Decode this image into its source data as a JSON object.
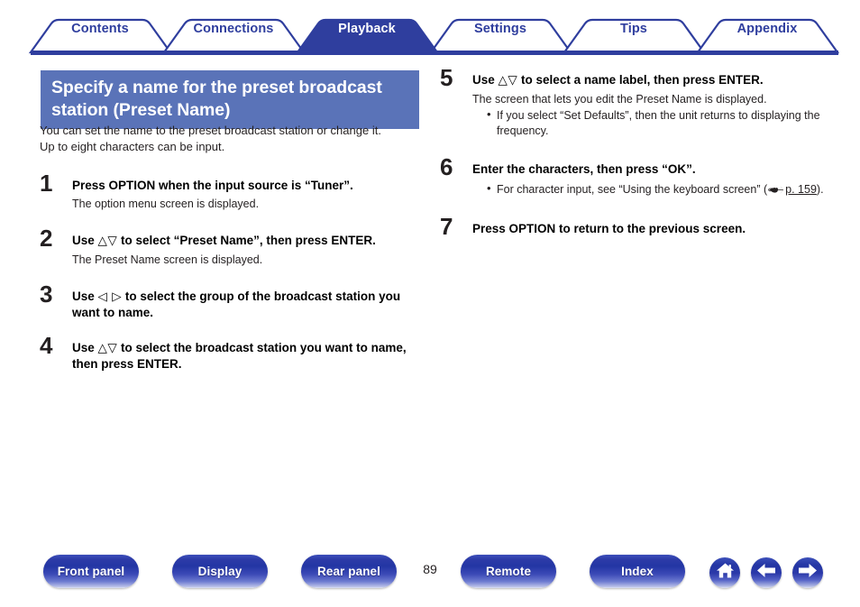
{
  "tabs": [
    {
      "label": "Contents",
      "active": false
    },
    {
      "label": "Connections",
      "active": false
    },
    {
      "label": "Playback",
      "active": true
    },
    {
      "label": "Settings",
      "active": false
    },
    {
      "label": "Tips",
      "active": false
    },
    {
      "label": "Appendix",
      "active": false
    }
  ],
  "heading": "Specify a name for the preset broadcast station (Preset Name)",
  "intro_line1": "You can set the name to the preset broadcast station or change it.",
  "intro_line2": "Up to eight characters can be input.",
  "steps_left": [
    {
      "num": "1",
      "title": "Press OPTION when the input source is “Tuner”.",
      "desc": "The option menu screen is displayed."
    },
    {
      "num": "2",
      "title_pre": "Use ",
      "arrows": "△▽",
      "title_post": " to select “Preset Name”, then press ENTER.",
      "desc": "The Preset Name screen is displayed."
    },
    {
      "num": "3",
      "title_pre": "Use ",
      "arrows": "◁ ▷",
      "title_post": " to select the group of the broadcast station you want to name."
    },
    {
      "num": "4",
      "title_pre": "Use ",
      "arrows": "△▽",
      "title_post": " to select the broadcast station you want to name, then press ENTER."
    }
  ],
  "steps_right": [
    {
      "num": "5",
      "title_pre": "Use ",
      "arrows": "△▽",
      "title_post": " to select a name label, then press ENTER.",
      "desc": "The screen that lets you edit the Preset Name is displayed.",
      "bullet": "If you select “Set Defaults”, then the unit returns to displaying the frequency."
    },
    {
      "num": "6",
      "title": "Enter the characters, then press “OK”.",
      "bullet_pre": "For character input, see “Using the keyboard screen” (",
      "bullet_link": "p. 159",
      "bullet_post": ")."
    },
    {
      "num": "7",
      "title": "Press OPTION to return to the previous screen."
    }
  ],
  "footer": {
    "buttons": [
      {
        "label": "Front panel"
      },
      {
        "label": "Display"
      },
      {
        "label": "Rear panel"
      },
      {
        "label": "Remote"
      },
      {
        "label": "Index"
      }
    ],
    "page_number": "89",
    "icons": [
      {
        "name": "home-icon"
      },
      {
        "name": "arrow-left-icon"
      },
      {
        "name": "arrow-right-icon"
      }
    ]
  },
  "colors": {
    "tab_blue": "#2f3e9e",
    "tab_active_fill": "#2f3e9e",
    "heading_bg": "#5a73b8",
    "button_blue": "#2336a4"
  }
}
